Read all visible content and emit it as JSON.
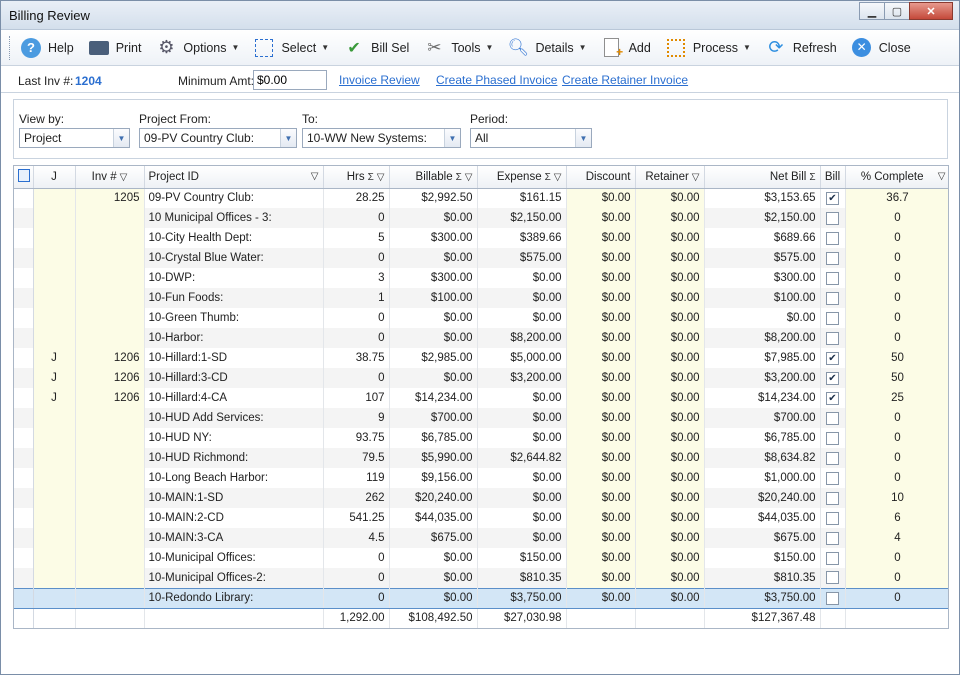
{
  "window": {
    "title": "Billing Review"
  },
  "toolbar": [
    {
      "label": "Help",
      "icon": "help-icon",
      "caret": false
    },
    {
      "label": "Print",
      "icon": "printer-icon",
      "caret": false
    },
    {
      "label": "Options",
      "icon": "options-icon",
      "caret": true
    },
    {
      "label": "Select",
      "icon": "select-icon",
      "caret": true
    },
    {
      "label": "Bill Sel",
      "icon": "bill-select-icon",
      "caret": false
    },
    {
      "label": "Tools",
      "icon": "tools-icon",
      "caret": true
    },
    {
      "label": "Details",
      "icon": "details-icon",
      "caret": true
    },
    {
      "label": "Add",
      "icon": "add-document-icon",
      "caret": false
    },
    {
      "label": "Process",
      "icon": "process-icon",
      "caret": true
    },
    {
      "label": "Refresh",
      "icon": "refresh-icon",
      "caret": false
    },
    {
      "label": "Close",
      "icon": "close-icon",
      "caret": false
    }
  ],
  "header": {
    "last_inv_label": "Last Inv #:",
    "last_inv_value": "1204",
    "min_amt_label": "Minimum Amt:",
    "min_amt_value": "$0.00",
    "links": [
      "Invoice Review",
      "Create Phased Invoice",
      "Create Retainer Invoice"
    ]
  },
  "filters": {
    "view_by": {
      "label": "View by:",
      "value": "Project"
    },
    "project_from": {
      "label": "Project From:",
      "value": "09-PV Country Club:"
    },
    "to": {
      "label": "To:",
      "value": "10-WW New Systems:"
    },
    "period": {
      "label": "Period:",
      "value": "All"
    }
  },
  "grid": {
    "columns": [
      "J",
      "Inv #",
      "Project ID",
      "Hrs",
      "Billable",
      "Expense",
      "Discount",
      "Retainer",
      "Net Bill",
      "Bill",
      "% Complete"
    ],
    "rows": [
      {
        "j": "",
        "inv": "1205",
        "project": "09-PV Country Club:",
        "hrs": "28.25",
        "billable": "$2,992.50",
        "expense": "$161.15",
        "discount": "$0.00",
        "retainer": "$0.00",
        "net": "$3,153.65",
        "bill": true,
        "complete": "36.7"
      },
      {
        "j": "",
        "inv": "",
        "project": "10 Municipal Offices - 3:",
        "hrs": "0",
        "billable": "$0.00",
        "expense": "$2,150.00",
        "discount": "$0.00",
        "retainer": "$0.00",
        "net": "$2,150.00",
        "bill": false,
        "complete": "0"
      },
      {
        "j": "",
        "inv": "",
        "project": "10-City Health Dept:",
        "hrs": "5",
        "billable": "$300.00",
        "expense": "$389.66",
        "discount": "$0.00",
        "retainer": "$0.00",
        "net": "$689.66",
        "bill": false,
        "complete": "0"
      },
      {
        "j": "",
        "inv": "",
        "project": "10-Crystal Blue Water:",
        "hrs": "0",
        "billable": "$0.00",
        "expense": "$575.00",
        "discount": "$0.00",
        "retainer": "$0.00",
        "net": "$575.00",
        "bill": false,
        "complete": "0"
      },
      {
        "j": "",
        "inv": "",
        "project": "10-DWP:",
        "hrs": "3",
        "billable": "$300.00",
        "expense": "$0.00",
        "discount": "$0.00",
        "retainer": "$0.00",
        "net": "$300.00",
        "bill": false,
        "complete": "0"
      },
      {
        "j": "",
        "inv": "",
        "project": "10-Fun Foods:",
        "hrs": "1",
        "billable": "$100.00",
        "expense": "$0.00",
        "discount": "$0.00",
        "retainer": "$0.00",
        "net": "$100.00",
        "bill": false,
        "complete": "0"
      },
      {
        "j": "",
        "inv": "",
        "project": "10-Green Thumb:",
        "hrs": "0",
        "billable": "$0.00",
        "expense": "$0.00",
        "discount": "$0.00",
        "retainer": "$0.00",
        "net": "$0.00",
        "bill": false,
        "complete": "0"
      },
      {
        "j": "",
        "inv": "",
        "project": "10-Harbor:",
        "hrs": "0",
        "billable": "$0.00",
        "expense": "$8,200.00",
        "discount": "$0.00",
        "retainer": "$0.00",
        "net": "$8,200.00",
        "bill": false,
        "complete": "0"
      },
      {
        "j": "J",
        "inv": "1206",
        "project": "10-Hillard:1-SD",
        "hrs": "38.75",
        "billable": "$2,985.00",
        "expense": "$5,000.00",
        "discount": "$0.00",
        "retainer": "$0.00",
        "net": "$7,985.00",
        "bill": true,
        "complete": "50"
      },
      {
        "j": "J",
        "inv": "1206",
        "project": "10-Hillard:3-CD",
        "hrs": "0",
        "billable": "$0.00",
        "expense": "$3,200.00",
        "discount": "$0.00",
        "retainer": "$0.00",
        "net": "$3,200.00",
        "bill": true,
        "complete": "50"
      },
      {
        "j": "J",
        "inv": "1206",
        "project": "10-Hillard:4-CA",
        "hrs": "107",
        "billable": "$14,234.00",
        "expense": "$0.00",
        "discount": "$0.00",
        "retainer": "$0.00",
        "net": "$14,234.00",
        "bill": true,
        "complete": "25"
      },
      {
        "j": "",
        "inv": "",
        "project": "10-HUD Add Services:",
        "hrs": "9",
        "billable": "$700.00",
        "expense": "$0.00",
        "discount": "$0.00",
        "retainer": "$0.00",
        "net": "$700.00",
        "bill": false,
        "complete": "0"
      },
      {
        "j": "",
        "inv": "",
        "project": "10-HUD NY:",
        "hrs": "93.75",
        "billable": "$6,785.00",
        "expense": "$0.00",
        "discount": "$0.00",
        "retainer": "$0.00",
        "net": "$6,785.00",
        "bill": false,
        "complete": "0"
      },
      {
        "j": "",
        "inv": "",
        "project": "10-HUD Richmond:",
        "hrs": "79.5",
        "billable": "$5,990.00",
        "expense": "$2,644.82",
        "discount": "$0.00",
        "retainer": "$0.00",
        "net": "$8,634.82",
        "bill": false,
        "complete": "0"
      },
      {
        "j": "",
        "inv": "",
        "project": "10-Long Beach Harbor:",
        "hrs": "119",
        "billable": "$9,156.00",
        "expense": "$0.00",
        "discount": "$0.00",
        "retainer": "$0.00",
        "net": "$1,000.00",
        "bill": false,
        "complete": "0"
      },
      {
        "j": "",
        "inv": "",
        "project": "10-MAIN:1-SD",
        "hrs": "262",
        "billable": "$20,240.00",
        "expense": "$0.00",
        "discount": "$0.00",
        "retainer": "$0.00",
        "net": "$20,240.00",
        "bill": false,
        "complete": "10"
      },
      {
        "j": "",
        "inv": "",
        "project": "10-MAIN:2-CD",
        "hrs": "541.25",
        "billable": "$44,035.00",
        "expense": "$0.00",
        "discount": "$0.00",
        "retainer": "$0.00",
        "net": "$44,035.00",
        "bill": false,
        "complete": "6"
      },
      {
        "j": "",
        "inv": "",
        "project": "10-MAIN:3-CA",
        "hrs": "4.5",
        "billable": "$675.00",
        "expense": "$0.00",
        "discount": "$0.00",
        "retainer": "$0.00",
        "net": "$675.00",
        "bill": false,
        "complete": "4"
      },
      {
        "j": "",
        "inv": "",
        "project": "10-Municipal Offices:",
        "hrs": "0",
        "billable": "$0.00",
        "expense": "$150.00",
        "discount": "$0.00",
        "retainer": "$0.00",
        "net": "$150.00",
        "bill": false,
        "complete": "0"
      },
      {
        "j": "",
        "inv": "",
        "project": "10-Municipal Offices-2:",
        "hrs": "0",
        "billable": "$0.00",
        "expense": "$810.35",
        "discount": "$0.00",
        "retainer": "$0.00",
        "net": "$810.35",
        "bill": false,
        "complete": "0"
      },
      {
        "j": "",
        "inv": "",
        "project": "10-Redondo Library:",
        "hrs": "0",
        "billable": "$0.00",
        "expense": "$3,750.00",
        "discount": "$0.00",
        "retainer": "$0.00",
        "net": "$3,750.00",
        "bill": false,
        "complete": "0",
        "selected": true
      }
    ],
    "totals": {
      "hrs": "1,292.00",
      "billable": "$108,492.50",
      "expense": "$27,030.98",
      "net": "$127,367.48"
    }
  }
}
